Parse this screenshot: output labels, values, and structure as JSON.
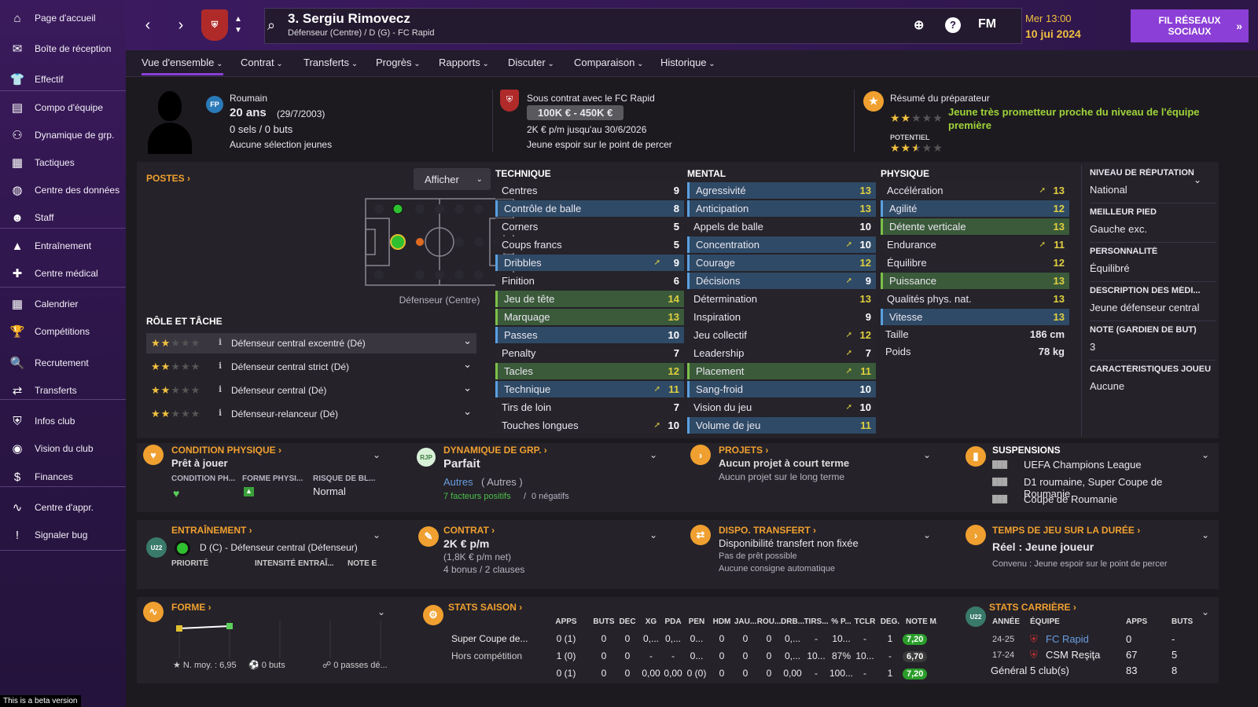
{
  "sidebar": {
    "items": [
      {
        "label": "Page d'accueil",
        "icon": "home-icon",
        "glyph": "⌂"
      },
      {
        "label": "Boîte de réception",
        "icon": "inbox-icon",
        "glyph": "✉"
      },
      {
        "label": "Effectif",
        "icon": "shirt-icon",
        "glyph": "👕"
      },
      {
        "label": "Compo d'équipe",
        "icon": "clipboard-icon",
        "glyph": "▤"
      },
      {
        "label": "Dynamique de grp.",
        "icon": "group-icon",
        "glyph": "⚇"
      },
      {
        "label": "Tactiques",
        "icon": "tactics-icon",
        "glyph": "▦"
      },
      {
        "label": "Centre des données",
        "icon": "data-icon",
        "glyph": "◍"
      },
      {
        "label": "Staff",
        "icon": "staff-icon",
        "glyph": "☻"
      },
      {
        "label": "Entraînement",
        "icon": "training-icon",
        "glyph": "▲"
      },
      {
        "label": "Centre médical",
        "icon": "medical-icon",
        "glyph": "✚"
      },
      {
        "label": "Calendrier",
        "icon": "calendar-icon",
        "glyph": "▦"
      },
      {
        "label": "Compétitions",
        "icon": "trophy-icon",
        "glyph": "🏆"
      },
      {
        "label": "Recrutement",
        "icon": "scouting-icon",
        "glyph": "🔍"
      },
      {
        "label": "Transferts",
        "icon": "transfers-icon",
        "glyph": "⇄"
      },
      {
        "label": "Infos club",
        "icon": "club-info-icon",
        "glyph": "⛨"
      },
      {
        "label": "Vision du club",
        "icon": "club-vision-icon",
        "glyph": "◉"
      },
      {
        "label": "Finances",
        "icon": "finances-icon",
        "glyph": "$"
      },
      {
        "label": "Centre d'appr.",
        "icon": "learning-icon",
        "glyph": "∿"
      },
      {
        "label": "Signaler bug",
        "icon": "bug-icon",
        "glyph": "!"
      }
    ],
    "beta": "This is a beta version"
  },
  "header": {
    "name": "3. Sergiu Rimovecz",
    "sub": "Défenseur (Centre) / D (G) - FC Rapid",
    "fm": "FM",
    "day": "Mer 13:00",
    "date": "10 jui 2024",
    "social": "FIL RÉSEAUX SOCIAUX"
  },
  "tabs": [
    "Vue d'ensemble",
    "Contrat",
    "Transferts",
    "Progrès",
    "Rapports",
    "Discuter",
    "Comparaison",
    "Historique"
  ],
  "profile": {
    "nat": "Roumain",
    "age": "20 ans",
    "dob": "(29/7/2003)",
    "caps": "0 sels / 0 buts",
    "youth": "Aucune sélection jeunes",
    "badge": "FP",
    "contract_title": "Sous contrat avec le FC Rapid",
    "value": "100K € - 450K €",
    "wage": "2K € p/m jusqu'au 30/6/2026",
    "status": "Jeune espoir sur le point de percer",
    "coach_title": "Résumé du préparateur",
    "coach_text": "Jeune très prometteur proche du niveau de l'équipe première",
    "potential": "POTENTIEL",
    "current_stars": 2,
    "potential_stars": 2.5
  },
  "positions": {
    "title": "POSTES",
    "afficher": "Afficher",
    "label": "Défenseur (Centre)",
    "role_title": "RÔLE ET TÂCHE",
    "roles": [
      {
        "name": "Défenseur central excentré (Dé)",
        "stars": 2
      },
      {
        "name": "Défenseur central strict (Dé)",
        "stars": 2
      },
      {
        "name": "Défenseur central (Dé)",
        "stars": 2
      },
      {
        "name": "Défenseur-relanceur (Dé)",
        "stars": 2
      }
    ]
  },
  "technique": {
    "title": "TECHNIQUE",
    "rows": [
      {
        "n": "Centres",
        "v": "9",
        "h": ""
      },
      {
        "n": "Contrôle de balle",
        "v": "8",
        "h": "blue"
      },
      {
        "n": "Corners",
        "v": "5",
        "h": ""
      },
      {
        "n": "Coups francs",
        "v": "5",
        "h": ""
      },
      {
        "n": "Dribbles",
        "v": "9",
        "h": "blue",
        "a": true
      },
      {
        "n": "Finition",
        "v": "6",
        "h": ""
      },
      {
        "n": "Jeu de tête",
        "v": "14",
        "h": "green"
      },
      {
        "n": "Marquage",
        "v": "13",
        "h": "green"
      },
      {
        "n": "Passes",
        "v": "10",
        "h": "blue"
      },
      {
        "n": "Penalty",
        "v": "7",
        "h": ""
      },
      {
        "n": "Tacles",
        "v": "12",
        "h": "green"
      },
      {
        "n": "Technique",
        "v": "11",
        "h": "blue",
        "a": true
      },
      {
        "n": "Tirs de loin",
        "v": "7",
        "h": ""
      },
      {
        "n": "Touches longues",
        "v": "10",
        "h": "",
        "a": true
      }
    ]
  },
  "mental": {
    "title": "MENTAL",
    "rows": [
      {
        "n": "Agressivité",
        "v": "13",
        "h": "blue"
      },
      {
        "n": "Anticipation",
        "v": "13",
        "h": "blue"
      },
      {
        "n": "Appels de balle",
        "v": "10",
        "h": ""
      },
      {
        "n": "Concentration",
        "v": "10",
        "h": "blue",
        "a": true
      },
      {
        "n": "Courage",
        "v": "12",
        "h": "blue"
      },
      {
        "n": "Décisions",
        "v": "9",
        "h": "blue",
        "a": true
      },
      {
        "n": "Détermination",
        "v": "13",
        "h": ""
      },
      {
        "n": "Inspiration",
        "v": "9",
        "h": ""
      },
      {
        "n": "Jeu collectif",
        "v": "12",
        "h": "",
        "a": true
      },
      {
        "n": "Leadership",
        "v": "7",
        "h": "",
        "a": true
      },
      {
        "n": "Placement",
        "v": "11",
        "h": "green",
        "a": true
      },
      {
        "n": "Sang-froid",
        "v": "10",
        "h": "blue"
      },
      {
        "n": "Vision du jeu",
        "v": "10",
        "h": "",
        "a": true
      },
      {
        "n": "Volume de jeu",
        "v": "11",
        "h": "blue"
      }
    ]
  },
  "physique": {
    "title": "PHYSIQUE",
    "rows": [
      {
        "n": "Accélération",
        "v": "13",
        "h": "",
        "a": true
      },
      {
        "n": "Agilité",
        "v": "12",
        "h": "blue"
      },
      {
        "n": "Détente verticale",
        "v": "13",
        "h": "green"
      },
      {
        "n": "Endurance",
        "v": "11",
        "h": "",
        "a": true
      },
      {
        "n": "Équilibre",
        "v": "12",
        "h": ""
      },
      {
        "n": "Puissance",
        "v": "13",
        "h": "green"
      },
      {
        "n": "Qualités phys. nat.",
        "v": "13",
        "h": ""
      },
      {
        "n": "Vitesse",
        "v": "13",
        "h": "blue"
      }
    ],
    "height_l": "Taille",
    "height": "186 cm",
    "weight_l": "Poids",
    "weight": "78 kg"
  },
  "info": [
    {
      "h": "NIVEAU DE RÉPUTATION",
      "v": "National"
    },
    {
      "h": "MEILLEUR PIED",
      "v": "Gauche exc."
    },
    {
      "h": "PERSONNALITÉ",
      "v": "Équilibré"
    },
    {
      "h": "DESCRIPTION DES MÉDI...",
      "v": "Jeune défenseur central"
    },
    {
      "h": "NOTE (GARDIEN DE BUT)",
      "v": "3"
    },
    {
      "h": "CARACTÉRISTIQUES JOUEU",
      "v": "Aucune"
    }
  ],
  "cond": {
    "title": "CONDITION PHYSIQUE",
    "val": "Prêt à jouer",
    "c1": "CONDITION PH...",
    "c2": "FORME PHYSI...",
    "c3": "RISQUE DE BL...",
    "risk": "Normal"
  },
  "dyn": {
    "title": "DYNAMIQUE DE GRP.",
    "val": "Parfait",
    "badge": "RJP",
    "other": "Autres",
    "other2": "( Autres )",
    "pos": "7 facteurs positifs",
    "sep": "/",
    "neg": "0 négatifs"
  },
  "proj": {
    "title": "PROJETS",
    "v1": "Aucun projet à court terme",
    "v2": "Aucun projet sur le long terme"
  },
  "susp": {
    "title": "SUSPENSIONS",
    "v1": "UEFA Champions League",
    "v2": "D1 roumaine, Super Coupe de Roumanie",
    "v3": "Coupe de Roumanie"
  },
  "train": {
    "title": "ENTRAÎNEMENT",
    "val": "D (C) - Défenseur central (Défenseur)",
    "h1": "PRIORITÉ",
    "h2": "INTENSITÉ ENTRAÎ...",
    "h3": "NOTE E",
    "badge": "U22"
  },
  "contract": {
    "title": "CONTRAT",
    "val": "2K € p/m",
    "net": "(1,8K € p/m net)",
    "bonus": "4 bonus / 2 clauses"
  },
  "dispo": {
    "title": "DISPO. TRANSFERT",
    "val": "Disponibilité transfert non fixée",
    "loan": "Pas de prêt possible",
    "auto": "Aucune consigne automatique"
  },
  "playtime": {
    "title": "TEMPS DE JEU SUR LA DURÉE",
    "val": "Réel : Jeune joueur",
    "agreed": "Convenu : Jeune espoir sur le point de percer"
  },
  "form": {
    "title": "FORME",
    "avg": "N. moy. : 6,95",
    "goals": "0 buts",
    "assists": "0 passes dé..."
  },
  "season": {
    "title": "STATS SAISON",
    "headers": [
      "APPS",
      "BUTS",
      "DÉC",
      "XG",
      "PDA",
      "PEN",
      "HDM",
      "JAU...",
      "ROU...",
      "DRB...",
      "TIRS...",
      "% P...",
      "TCLR",
      "DÉG.",
      "NOTE M..."
    ],
    "rows": [
      {
        "label": "Super Coupe de...",
        "cells": [
          "0 (1)",
          "0",
          "0",
          "0,...",
          "0,...",
          "0...",
          "0",
          "0",
          "0",
          "0,...",
          "-",
          "10...",
          "-",
          "1"
        ],
        "rating": "7,20",
        "rc": "#2a9d2a"
      },
      {
        "label": "Hors compétition",
        "cells": [
          "1 (0)",
          "0",
          "0",
          "-",
          "-",
          "0...",
          "0",
          "0",
          "0",
          "0,...",
          "10...",
          "87%",
          "10...",
          "-"
        ],
        "rating": "6,70",
        "rc": "#3a3a3a"
      },
      {
        "label": "",
        "cells": [
          "0 (1)",
          "0",
          "0",
          "0,00",
          "0,00",
          "0 (0)",
          "0",
          "0",
          "0",
          "0,00",
          "-",
          "100...",
          "-",
          "1"
        ],
        "rating": "7,20",
        "rc": "#2a9d2a"
      }
    ]
  },
  "career": {
    "title": "STATS CARRIÈRE",
    "h_year": "ANNÉE",
    "h_team": "ÉQUIPE",
    "h_apps": "APPS",
    "h_goals": "BUTS",
    "badge": "U22",
    "rows": [
      {
        "year": "24-25",
        "team": "FC Rapid",
        "apps": "0",
        "goals": "-",
        "link": true
      },
      {
        "year": "17-24",
        "team": "CSM Reşiţa",
        "apps": "67",
        "goals": "5",
        "link": false
      }
    ],
    "total_l": "Général",
    "total_t": "5 club(s)",
    "total_apps": "83",
    "total_goals": "8"
  }
}
